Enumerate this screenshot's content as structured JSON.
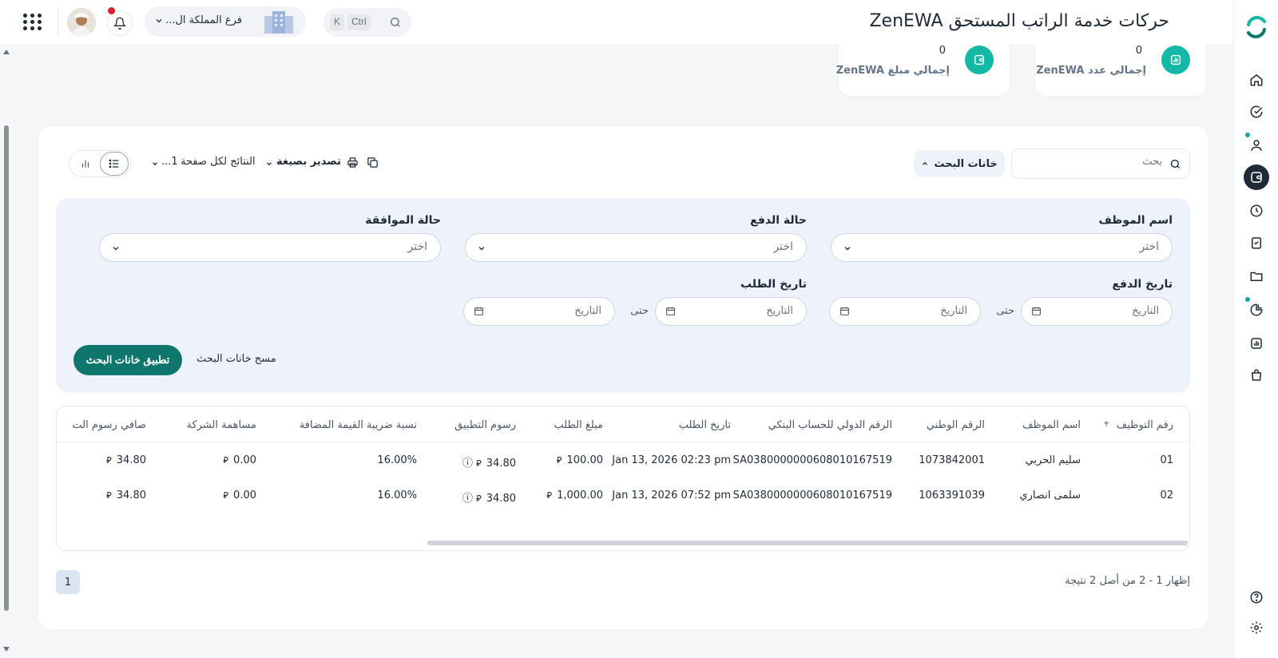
{
  "header": {
    "title": "حركات خدمة الراتب المستحق ZenEWA",
    "branch_label": "فرع المملكة ال...",
    "search_kbd_1": "Ctrl",
    "search_kbd_2": "K"
  },
  "stats": [
    {
      "label": "إجمالي عدد ZenEWA",
      "value": "0",
      "icon": "chart-icon"
    },
    {
      "label": "إجمالي مبلغ ZenEWA",
      "value": "0",
      "icon": "wallet-icon"
    }
  ],
  "toolbar": {
    "search_placeholder": "بحث",
    "search_fields_label": "خانات البحث",
    "export_label": "تصدير بصيغة",
    "per_page_label": "النتائج لكل صفحة",
    "per_page_value": "1..."
  },
  "filters": {
    "employee_name": {
      "label": "اسم الموظف",
      "placeholder": "اختر"
    },
    "payment_status": {
      "label": "حالة الدفع",
      "placeholder": "اختر"
    },
    "approval_status": {
      "label": "حالة الموافقة",
      "placeholder": "اختر"
    },
    "payment_date": {
      "label": "تاريخ الدفع",
      "from_placeholder": "التاريخ",
      "to_placeholder": "التاريخ",
      "until": "حتى"
    },
    "request_date": {
      "label": "تاريخ الطلب",
      "from_placeholder": "التاريخ",
      "to_placeholder": "التاريخ",
      "until": "حتى"
    },
    "clear_label": "مسح خانات البحث",
    "apply_label": "تطبيق خانات البحث"
  },
  "table": {
    "headers": [
      "رقم التوظيف",
      "اسم الموظف",
      "الرقم الوطني",
      "الرقم الدولي للحساب البنكي",
      "تاريخ الطلب",
      "مبلغ الطلب",
      "رسوم التطبيق",
      "نسبة ضريبة القيمة المضافة",
      "مساهمة الشركة",
      "صافي رسوم الت"
    ],
    "rows": [
      {
        "emp_no": "01",
        "name": "سليم الحربي",
        "national_id": "1073842001",
        "iban": "SA0380000000608010167519",
        "request_date": "Jan 13, 2026 02:23 pm",
        "amount": "100.00",
        "app_fee": "34.80",
        "vat": "16.00%",
        "company_share": "0.00",
        "net_fee": "34.80"
      },
      {
        "emp_no": "02",
        "name": "سلمى انصاري",
        "national_id": "1063391039",
        "iban": "SA0380000000608010167519",
        "request_date": "Jan 13, 2026 07:52 pm",
        "amount": "1,000.00",
        "app_fee": "34.80",
        "vat": "16.00%",
        "company_share": "0.00",
        "net_fee": "34.80"
      }
    ]
  },
  "pagination": {
    "current_page": "1",
    "summary": "إظهار 1 - 2 من أصل 2 نتيجة"
  },
  "colors": {
    "accent": "#0f766e",
    "stat_icon": "#14b8a6",
    "notification_dot": "#e11d2e"
  }
}
